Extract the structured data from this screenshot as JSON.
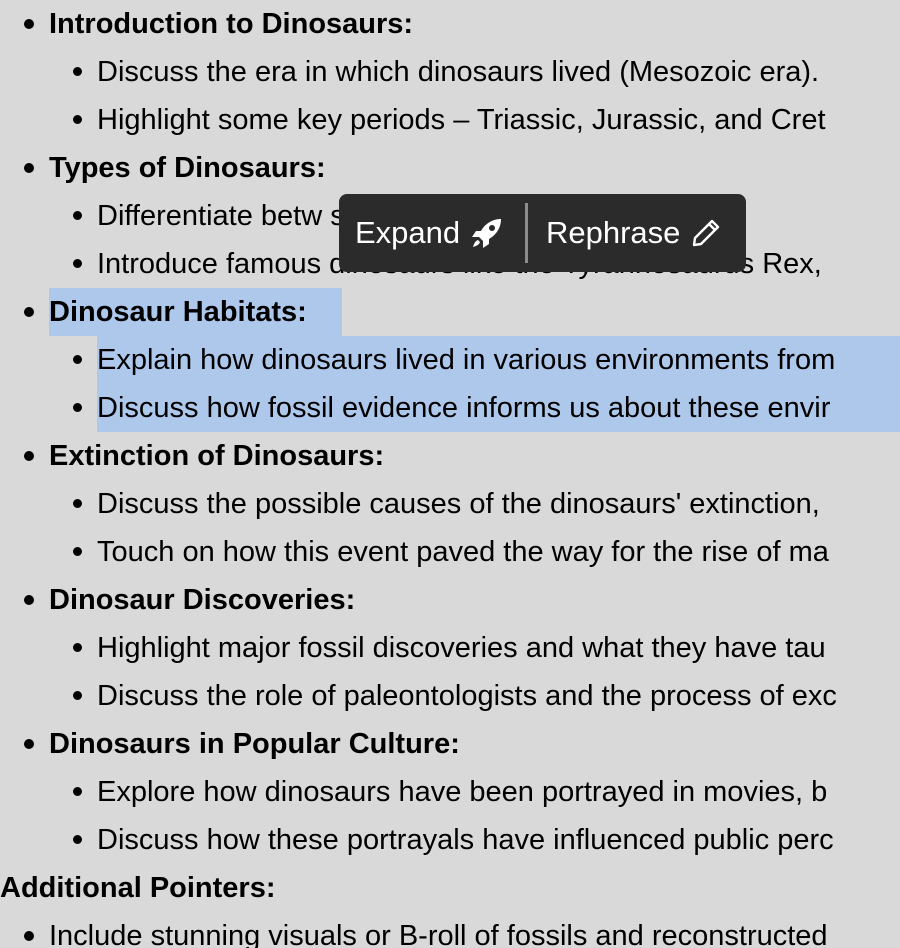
{
  "outline": [
    {
      "level": 1,
      "text": "Introduction to Dinosaurs:"
    },
    {
      "level": 2,
      "text": "Discuss the era in which dinosaurs lived (Mesozoic era)."
    },
    {
      "level": 2,
      "text": "Highlight some key periods – Triassic, Jurassic, and Cret"
    },
    {
      "level": 1,
      "text": "Types of Dinosaurs:"
    },
    {
      "level": 2,
      "text": "Differentiate betw                                             s, and omn"
    },
    {
      "level": 2,
      "text": "Introduce famous dinosaurs like the Tyrannosaurus Rex,"
    },
    {
      "level": 1,
      "text": "Dinosaur Habitats:",
      "highlighted": true
    },
    {
      "level": 2,
      "text": "Explain how dinosaurs lived in various environments from",
      "highlighted": true
    },
    {
      "level": 2,
      "text": "Discuss how fossil evidence informs us about these envir",
      "highlighted": true
    },
    {
      "level": 1,
      "text": "Extinction of Dinosaurs:"
    },
    {
      "level": 2,
      "text": "Discuss the possible causes of the dinosaurs' extinction,"
    },
    {
      "level": 2,
      "text": "Touch on how this event paved the way for the rise of ma"
    },
    {
      "level": 1,
      "text": "Dinosaur Discoveries:"
    },
    {
      "level": 2,
      "text": "Highlight major fossil discoveries and what they have tau"
    },
    {
      "level": 2,
      "text": "Discuss the role of paleontologists and the process of exc"
    },
    {
      "level": 1,
      "text": "Dinosaurs in Popular Culture:"
    },
    {
      "level": 2,
      "text": "Explore how dinosaurs have been portrayed in movies, b"
    },
    {
      "level": 2,
      "text": "Discuss how these portrayals have influenced public perc"
    },
    {
      "level": 0,
      "text": "Additional Pointers:"
    },
    {
      "level": 1,
      "text": "Include stunning visuals or B-roll of fossils and reconstructed",
      "plain": true
    }
  ],
  "popup": {
    "expand_label": "Expand",
    "expand_icon": "rocket-icon",
    "rephrase_label": "Rephrase",
    "rephrase_icon": "pencil-icon"
  },
  "colors": {
    "background": "#d9d9d9",
    "selection": "#aec8ec",
    "popup_bg": "#2b2b2b"
  }
}
